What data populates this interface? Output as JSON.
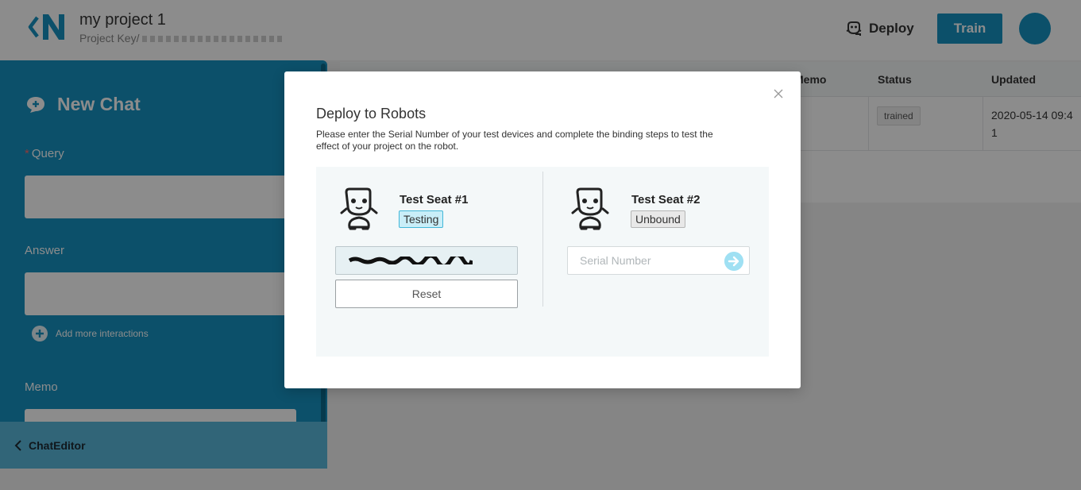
{
  "header": {
    "project_title": "my project 1",
    "project_key_label": "Project Key/",
    "deploy_label": "Deploy",
    "train_label": "Train"
  },
  "table": {
    "columns": [
      "Memo",
      "Status",
      "Updated"
    ],
    "rows": [
      {
        "status": "trained",
        "updated": "2020-05-14 09:41"
      }
    ]
  },
  "side_panel": {
    "title": "New Chat",
    "query_label": "Query",
    "answer_label": "Answer",
    "add_more_label": "Add more interactions",
    "memo_label": "Memo",
    "footer_label": "ChatEditor"
  },
  "modal": {
    "title": "Deploy to Robots",
    "description": "Please enter the Serial Number of your test devices and complete the binding steps to test the effect of your project on the robot.",
    "seats": [
      {
        "name": "Test Seat #1",
        "status": "Testing",
        "reset_label": "Reset"
      },
      {
        "name": "Test Seat #2",
        "status": "Unbound",
        "serial_placeholder": "Serial Number"
      }
    ]
  },
  "colors": {
    "brand": "#1693c1",
    "testing_tag_bg": "#c9eef8",
    "go_button": "#9fe0f3"
  },
  "icons": {
    "deploy": "robot-face-icon",
    "close": "close-icon",
    "robot": "robot-icon",
    "go": "arrow-right-circle-icon",
    "new_chat": "chat-plus-icon",
    "add_more": "plus-circle-icon",
    "back": "chevron-left-icon"
  }
}
